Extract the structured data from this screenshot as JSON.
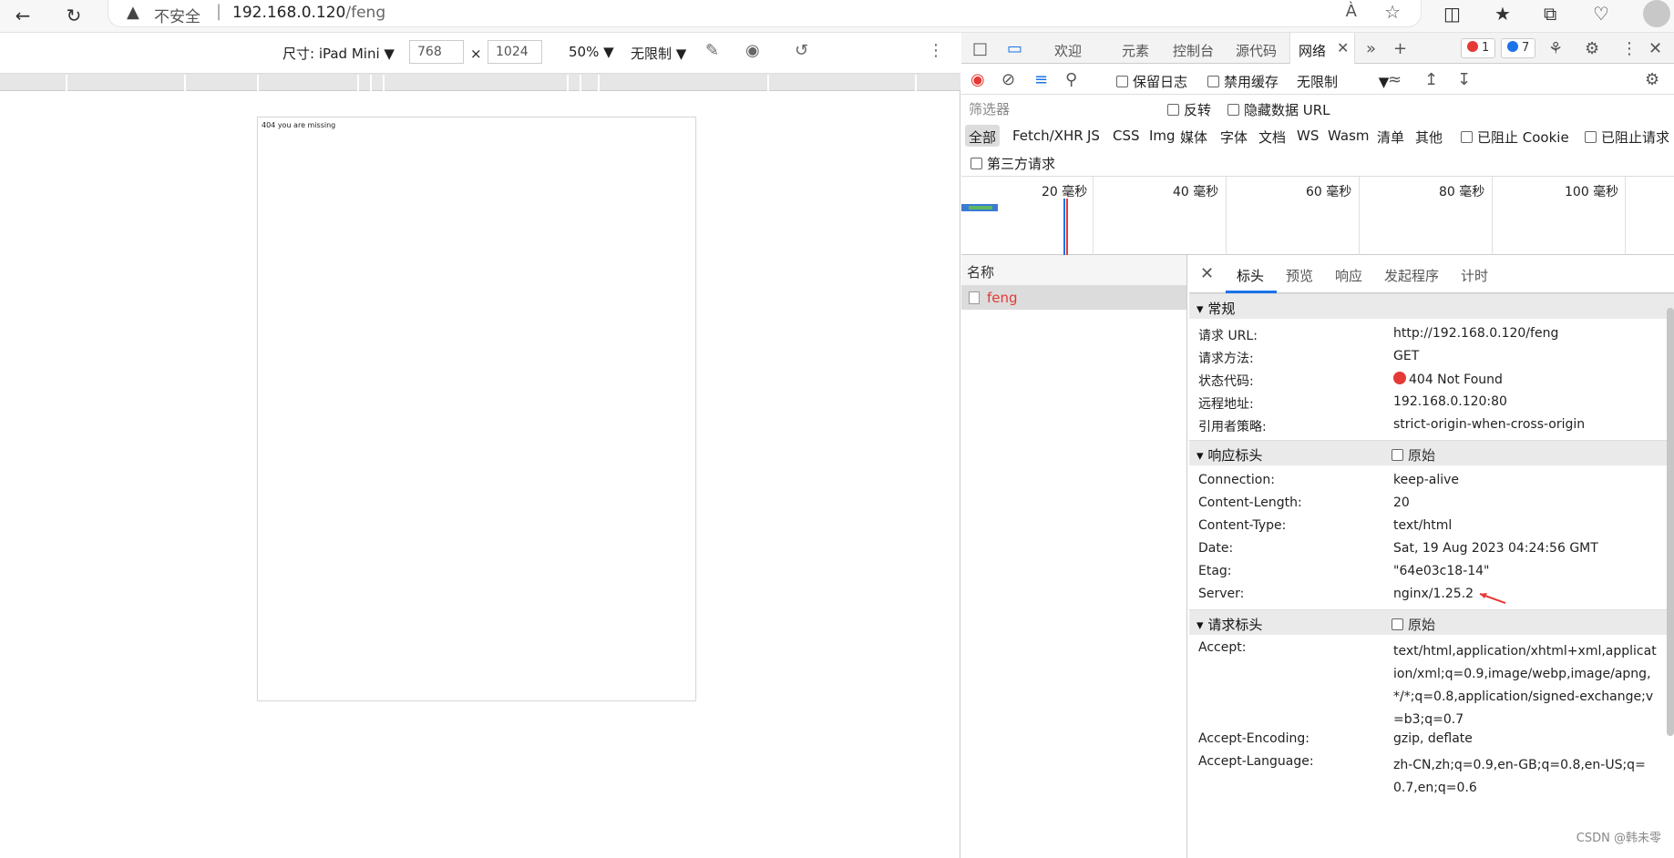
{
  "browser": {
    "security_label": "不安全",
    "url_host": "192.168.0.120",
    "url_path": "/feng",
    "read_aloud_label": "Á"
  },
  "device_toolbar": {
    "dimensions_label": "尺寸: iPad Mini",
    "width": "768",
    "times": "×",
    "height": "1024",
    "zoom": "50%",
    "throttle": "无限制"
  },
  "page": {
    "message": "404 you are missing"
  },
  "devtools": {
    "tabs": [
      "欢迎",
      "元素",
      "控制台",
      "源代码",
      "网络"
    ],
    "active_tab": "网络",
    "errors_count": "1",
    "messages_count": "7",
    "network_toolbar": {
      "preserve_log": "保留日志",
      "disable_cache": "禁用缓存",
      "throttle": "无限制"
    },
    "filter": {
      "placeholder": "筛选器",
      "invert": "反转",
      "hide_data_urls": "隐藏数据 URL"
    },
    "types": [
      "全部",
      "Fetch/XHR",
      "JS",
      "CSS",
      "Img",
      "媒体",
      "字体",
      "文档",
      "WS",
      "Wasm",
      "清单",
      "其他"
    ],
    "blocked_cookies": "已阻止 Cookie",
    "blocked_requests": "已阻止请求",
    "third_party": "第三方请求",
    "timeline_labels": [
      "20 毫秒",
      "40 毫秒",
      "60 毫秒",
      "80 毫秒",
      "100 毫秒"
    ],
    "name_column_header": "名称",
    "requests": [
      {
        "name": "feng"
      }
    ],
    "detail_tabs": [
      "标头",
      "预览",
      "响应",
      "发起程序",
      "计时"
    ],
    "general": {
      "title": "常规",
      "rows": [
        {
          "k": "请求 URL:",
          "v": "http://192.168.0.120/feng"
        },
        {
          "k": "请求方法:",
          "v": "GET"
        },
        {
          "k": "状态代码:",
          "v": "404 Not Found"
        },
        {
          "k": "远程地址:",
          "v": "192.168.0.120:80"
        },
        {
          "k": "引用者策略:",
          "v": "strict-origin-when-cross-origin"
        }
      ]
    },
    "response_headers": {
      "title": "响应标头",
      "raw_label": "原始",
      "rows": [
        {
          "k": "Connection:",
          "v": "keep-alive"
        },
        {
          "k": "Content-Length:",
          "v": "20"
        },
        {
          "k": "Content-Type:",
          "v": "text/html"
        },
        {
          "k": "Date:",
          "v": "Sat, 19 Aug 2023 04:24:56 GMT"
        },
        {
          "k": "Etag:",
          "v": "\"64e03c18-14\""
        },
        {
          "k": "Server:",
          "v": "nginx/1.25.2"
        }
      ]
    },
    "request_headers": {
      "title": "请求标头",
      "raw_label": "原始",
      "rows": [
        {
          "k": "Accept:",
          "v": "text/html,application/xhtml+xml,application/xml;q=0.9,image/webp,image/apng,*/*;q=0.8,application/signed-exchange;v=b3;q=0.7"
        },
        {
          "k": "Accept-Encoding:",
          "v": "gzip, deflate"
        },
        {
          "k": "Accept-Language:",
          "v": "zh-CN,zh;q=0.9,en-GB;q=0.8,en-US;q=0.7,en;q=0.6"
        }
      ]
    }
  },
  "watermark": "CSDN @韩未零",
  "colors": {
    "error_red": "#e53935",
    "accent_blue": "#1a73e8"
  }
}
